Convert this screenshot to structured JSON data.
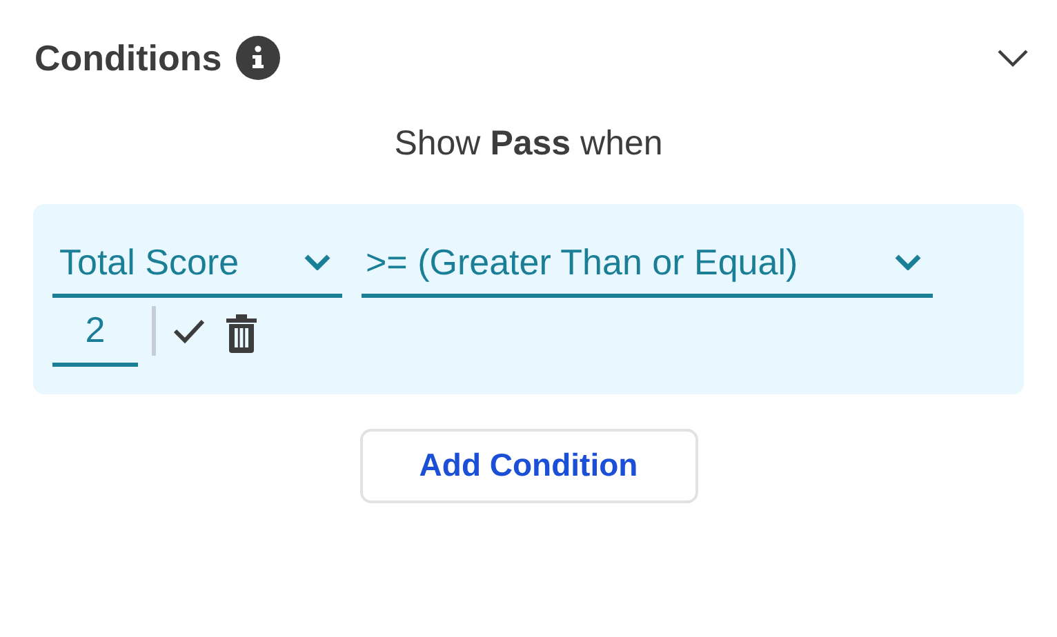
{
  "section": {
    "title": "Conditions"
  },
  "rule_heading": "Show **Pass** when",
  "condition": {
    "field": {
      "value": "Total Score"
    },
    "operator": {
      "value": ">= (Greater Than or Equal)"
    },
    "threshold": {
      "value": "2"
    }
  },
  "add_button": {
    "label": "Add Condition"
  }
}
